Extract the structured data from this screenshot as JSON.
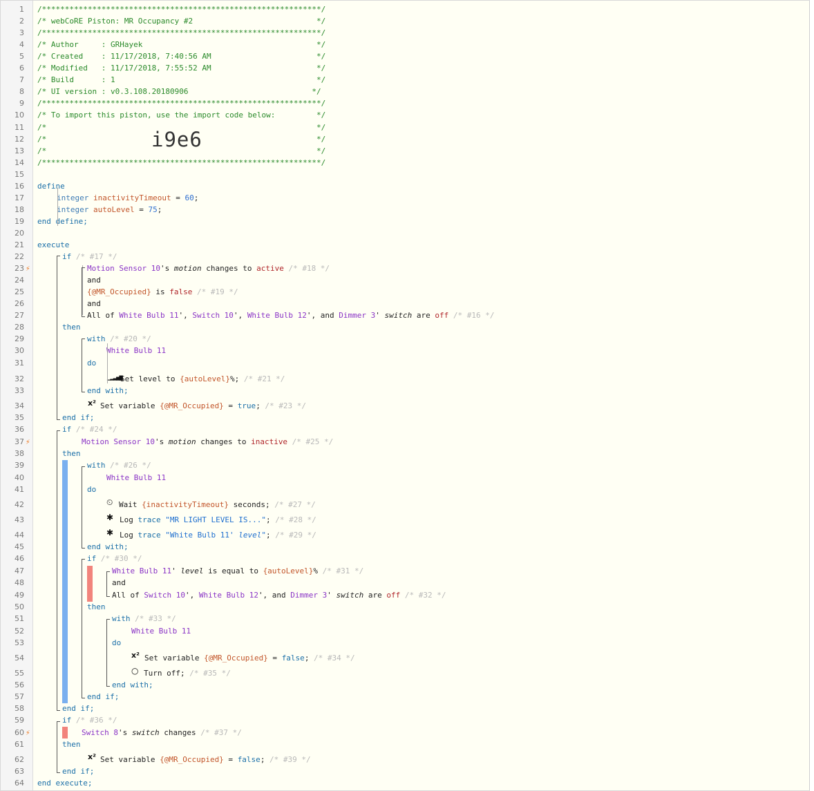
{
  "header": {
    "border": "/*************************************************************/",
    "piston": "/* webCoRE Piston: MR Occupancy #2                           */",
    "author": "/* Author     : GRHayek                                      */",
    "created": "/* Created    : 11/17/2018, 7:40:56 AM                       */",
    "modified": "/* Modified   : 11/17/2018, 7:55:52 AM                       */",
    "build": "/* Build      : 1                                            */",
    "ui_version": "/* UI version : v0.3.108.20180906                           */",
    "import_intro": "/* To import this piston, use the import code below:         */",
    "empty": "/*                                                           */",
    "import_code": "i9e6"
  },
  "line_numbers": [
    "1",
    "2",
    "3",
    "4",
    "5",
    "6",
    "7",
    "8",
    "9",
    "10",
    "11",
    "12",
    "13",
    "14",
    "15",
    "16",
    "17",
    "18",
    "19",
    "20",
    "21",
    "22",
    "23",
    "24",
    "25",
    "26",
    "27",
    "28",
    "29",
    "30",
    "31",
    "32",
    "33",
    "34",
    "35",
    "36",
    "37",
    "38",
    "39",
    "40",
    "41",
    "42",
    "43",
    "44",
    "45",
    "46",
    "47",
    "48",
    "49",
    "50",
    "51",
    "52",
    "53",
    "54",
    "55",
    "56",
    "57",
    "58",
    "59",
    "60",
    "61",
    "62",
    "63",
    "64"
  ],
  "define": {
    "open": "define",
    "close": "end define;",
    "var1_type": "integer",
    "var1_name": "inactivityTimeout",
    "var1_eq": " = ",
    "var1_value": "60",
    "var2_type": "integer",
    "var2_name": "autoLevel",
    "var2_eq": " = ",
    "var2_value": "75",
    "semicolon": ";"
  },
  "execute": {
    "open": "execute",
    "close": "end execute;"
  },
  "block1": {
    "if": "if",
    "if_cm": " /* #17 */",
    "cond1_dev": "Motion Sensor 10",
    "cond1_poss": "'s ",
    "cond1_attr": "motion",
    "cond1_op": " changes to ",
    "cond1_val": "active",
    "cond1_cm": " /* #18 */",
    "and1": "and",
    "cond2_var": "{@MR_Occupied}",
    "cond2_op": " is ",
    "cond2_val": "false",
    "cond2_cm": " /* #19 */",
    "and2": "and",
    "cond3_all": "All of ",
    "cond3_d1": "White Bulb 11",
    "cond3_s1": "', ",
    "cond3_d2": "Switch 10",
    "cond3_s2": "', ",
    "cond3_d3": "White Bulb 12",
    "cond3_s3": "', and ",
    "cond3_d4": "Dimmer 3",
    "cond3_s4": "' ",
    "cond3_attr": "switch",
    "cond3_op": " are ",
    "cond3_val": "off",
    "cond3_cm": " /* #16 */",
    "then": "then",
    "with": "with",
    "with_cm": " /* #20 */",
    "with_dev": "White Bulb 11",
    "do": "do",
    "action1_pre": "Set level to ",
    "action1_expr": "{autoLevel}",
    "action1_post": "%;",
    "action1_cm": " /* #21 */",
    "end_with": "end with;",
    "action2_pre": "Set variable ",
    "action2_var": "{@MR_Occupied}",
    "action2_eq": " = ",
    "action2_val": "true",
    "action2_post": ";",
    "action2_cm": " /* #23 */",
    "end_if": "end if;"
  },
  "block2": {
    "if": "if",
    "if_cm": " /* #24 */",
    "cond_dev": "Motion Sensor 10",
    "cond_poss": "'s ",
    "cond_attr": "motion",
    "cond_op": " changes to ",
    "cond_val": "inactive",
    "cond_cm": " /* #25 */",
    "then": "then",
    "with": "with",
    "with_cm": " /* #26 */",
    "with_dev": "White Bulb 11",
    "do": "do",
    "wait_pre": "Wait ",
    "wait_expr": "{inactivityTimeout}",
    "wait_post": " seconds;",
    "wait_cm": " /* #27 */",
    "log1_pre": "Log ",
    "log1_kw": "trace",
    "log1_str": " \"MR LIGHT LEVEL IS...\"",
    "log1_post": ";",
    "log1_cm": " /* #28 */",
    "log2_pre": "Log ",
    "log2_kw": "trace",
    "log2_str": " \"White Bulb 11",
    "log2_str2": "' ",
    "log2_attr": "level",
    "log2_str3": "\"",
    "log2_post": ";",
    "log2_cm": " /* #29 */",
    "end_with": "end with;",
    "inner_if": "if",
    "inner_if_cm": " /* #30 */",
    "icond1_dev": "White Bulb 11",
    "icond1_s": "' ",
    "icond1_attr": "level",
    "icond1_op": " is equal to ",
    "icond1_expr": "{autoLevel}",
    "icond1_post": "%",
    "icond1_cm": " /* #31 */",
    "iand": "and",
    "icond2_all": "All of ",
    "icond2_d1": "Switch 10",
    "icond2_s1": "', ",
    "icond2_d2": "White Bulb 12",
    "icond2_s2": "', and ",
    "icond2_d3": "Dimmer 3",
    "icond2_s3": "' ",
    "icond2_attr": "switch",
    "icond2_op": " are ",
    "icond2_val": "off",
    "icond2_cm": " /* #32 */",
    "inner_then": "then",
    "inner_with": "with",
    "inner_with_cm": " /* #33 */",
    "inner_with_dev": "White Bulb 11",
    "inner_do": "do",
    "iaction1_pre": "Set variable ",
    "iaction1_var": "{@MR_Occupied}",
    "iaction1_eq": " = ",
    "iaction1_val": "false",
    "iaction1_post": ";",
    "iaction1_cm": " /* #34 */",
    "iaction2_pre": "Turn off;",
    "iaction2_cm": " /* #35 */",
    "inner_end_with": "end with;",
    "inner_end_if": "end if;",
    "end_if": "end if;"
  },
  "block3": {
    "if": "if",
    "if_cm": " /* #36 */",
    "cond_dev": "Switch 8",
    "cond_poss": "'s ",
    "cond_attr": "switch",
    "cond_op": " changes",
    "cond_cm": " /* #37 */",
    "then": "then",
    "action_pre": "Set variable ",
    "action_var": "{@MR_Occupied}",
    "action_eq": " = ",
    "action_val": "false",
    "action_post": ";",
    "action_cm": " /* #39 */",
    "end_if": "end if;"
  },
  "icons": {
    "bolt": "lightning-icon",
    "level": "signal-bars-icon",
    "variable": "superscript-x2-icon",
    "wait": "clock-icon",
    "log": "bug-icon",
    "power": "power-icon"
  },
  "colors": {
    "bolt": "#ef7a22",
    "blue_bar": "#7ab0ef",
    "red_bar": "#f2847c",
    "comment": "#2a8a2a",
    "device": "#8a34c6"
  }
}
